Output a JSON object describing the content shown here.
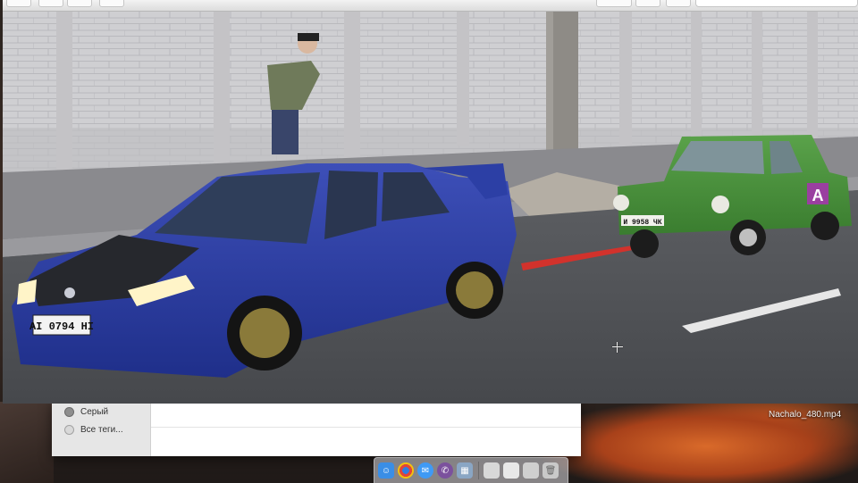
{
  "finder": {
    "tags": [
      {
        "label": "Серый",
        "color": "#8e8e8e"
      },
      {
        "label": "Все теги...",
        "color": "#d9d9d9"
      }
    ]
  },
  "player": {
    "video_plate_front": "AI 0794 HI",
    "video_plate_green_car": "И 9958 ЧК",
    "video_badge": "A"
  },
  "desktop": {
    "file_label": "Nachalo_480.mp4"
  },
  "dock": {
    "items": [
      {
        "name": "finder-icon",
        "color": "#3a8ee6"
      },
      {
        "name": "chrome-icon",
        "color": "#e0453a"
      },
      {
        "name": "messages-icon",
        "color": "#3f9af5"
      },
      {
        "name": "viber-icon",
        "color": "#7b519d"
      },
      {
        "name": "photos-icon",
        "color": "#8aa6c4"
      },
      {
        "name": "window-icon-1",
        "color": "#d8d8d8"
      },
      {
        "name": "window-icon-2",
        "color": "#e8e8e8"
      },
      {
        "name": "window-icon-3",
        "color": "#cfcfcf"
      },
      {
        "name": "trash-icon",
        "color": "#c9c9c9"
      }
    ]
  }
}
